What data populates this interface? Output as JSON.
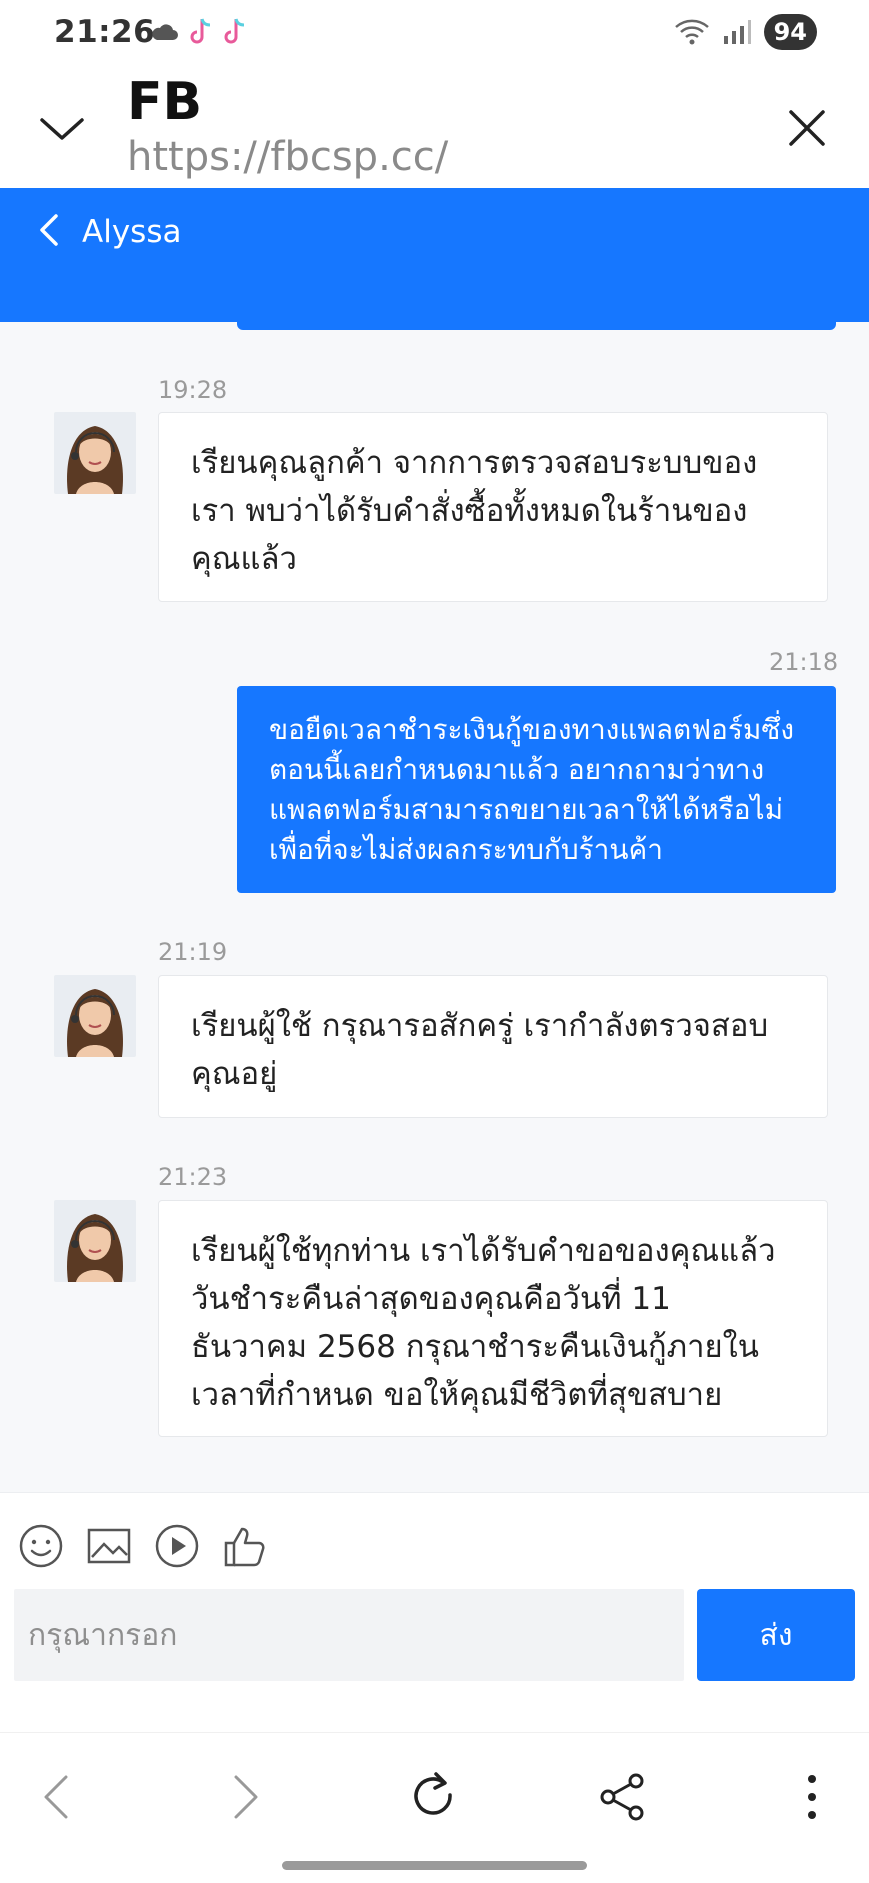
{
  "status_bar": {
    "time": "21:26",
    "battery": "94",
    "icons": [
      "cloud-icon",
      "tiktok-icon",
      "tiktok-icon",
      "wifi-icon",
      "signal-icon"
    ]
  },
  "browser": {
    "title": "FB",
    "url": "https://fbcsp.cc/"
  },
  "chat": {
    "contact_name": "Alyssa",
    "messages": [
      {
        "time": "19:28",
        "direction": "in",
        "text": "เรียนคุณลูกค้า จากการตรวจสอบระบบของเรา พบว่าได้รับคำสั่งซื้อทั้งหมดในร้านของคุณแล้ว"
      },
      {
        "time": "21:18",
        "direction": "out",
        "text": "ขอยืดเวลาชำระเงินกู้ของทางแพลตฟอร์มซึ่งตอนนี้เลยกำหนดมาแล้ว อยากถามว่าทางแพลตฟอร์มสามารถขยายเวลาให้ได้หรือไม่เพื่อที่จะไม่ส่งผลกระทบกับร้านค้า"
      },
      {
        "time": "21:19",
        "direction": "in",
        "text": "เรียนผู้ใช้ กรุณารอสักครู่ เรากำลังตรวจสอบคุณอยู่"
      },
      {
        "time": "21:23",
        "direction": "in",
        "text": "เรียนผู้ใช้ทุกท่าน เราได้รับคำขอของคุณแล้ว วันชำระคืนล่าสุดของคุณคือวันที่ 11 ธันวาคม 2568 กรุณาชำระคืนเงินกู้ภายในเวลาที่กำหนด ขอให้คุณมีชีวิตที่สุขสบาย"
      }
    ]
  },
  "composer": {
    "placeholder": "กรุณากรอก",
    "send_label": "ส่ง",
    "tools": [
      "emoji-icon",
      "image-icon",
      "video-icon",
      "thumbs-up-icon"
    ]
  },
  "bottom_nav": {
    "items": [
      "back-icon",
      "forward-icon",
      "refresh-icon",
      "share-icon",
      "more-icon"
    ]
  },
  "colors": {
    "accent": "#1677ff",
    "chat_bg": "#f7f8fa"
  }
}
